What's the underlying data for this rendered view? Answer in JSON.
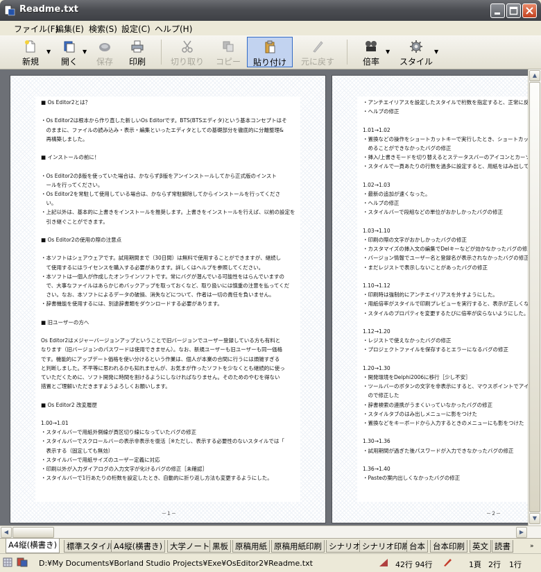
{
  "window": {
    "title": "Readme.txt"
  },
  "menu": [
    "ファイル(F)",
    "編集(E)",
    "検索(S)",
    "設定(C)",
    "ヘルプ(H)"
  ],
  "toolbar": {
    "new": "新規",
    "open": "開く",
    "save": "保存",
    "print": "印刷",
    "cut": "切り取り",
    "copy": "コピー",
    "paste": "貼り付け",
    "undo": "元に戻す",
    "zoom": "倍率",
    "style": "スタイル"
  },
  "left_page": {
    "lines": [
      "■ Os Editor2とは？",
      "",
      "・Os Editor2は根本から作り直した新しいOs Editorです。BTS(BTSエディタ)という基本コンセプトはそ",
      "　のままに、ファイルの読み込み・表示・編集といったエディタとしての基礎部分を徹底的に分離整理&",
      "　再構築しました。",
      "",
      "■ インストールの前に！",
      "",
      "・Os Editor2のβ版を使っていた場合は、かならずβ版をアンインストールしてから正式版のインスト",
      "　ールを行ってください。",
      "・Os Editor2を常駐して使用している場合は、かならず常駐解除してからインストールを行ってくださ",
      "　い。",
      "・上記以外は、基本的に上書きをインストールを推奨します。上書きをインストールを行えば、以前の設定を",
      "　引き継ぐことができます。",
      "",
      "■ Os Editor2の使用の際の注意点",
      "",
      "・本ソフトはシェアウェアです。試用期間まで（30日間）は無料で使用することができますが、継続し",
      "　て使用するにはライセンスを購入する必要があります。詳しくはヘルプを参照してください。",
      "・本ソフトは一個人が作成したオンラインソフトです。常にバグが潜んでいる可能性をはらんでいますの",
      "　で、大事なファイルはあらかじめバックアップを取っておくなど、取り扱いには慎重の注意を払ってくだ",
      "　さい。なお、本ソフトによるデータの破損、消失などについて、作者は一切の責任を負いません。",
      "・辞書機能を使用するには、別途辞書類をダウンロードする必要があります。",
      "",
      "■ 旧ユーザーの方へ",
      "",
      "Os Editor2はメジャーバージョンアップということで旧バージョンでユーザー登録している方も有料と",
      "なります（旧バージョンのパスワードは使用できません）。なお、新規ユーザーも旧ユーザーも同一価格",
      "です。機能的にアップデート価格を使い分けるという作業は、個人が本業の合間に行うには煩雑すぎる",
      "と判断しました。不平等に思われるかも知れませんが、お気まが作ったソフトを少なくとも継続的に使っ",
      "ていただくために、ソフト開発に時間を割けるようにしなければなりません。そのためのやむを得ない",
      "措置とご理解いただきますようよろしくお願いします。",
      "",
      "■ Os Editor2 改変履歴",
      "",
      "1.00→1.01",
      "・スタイルバーで用紙外側線が頁区切り線になっていたバグの修正",
      "・スタイルバーでスクロールバーの表示非表示を復活［※ただし、表示する必要性のないスタイルでは「",
      "　表示する（固定しても無効）",
      "・スタイルバーで用紙サイズのユーザー定義に対応",
      "・印刷以外が入力ダイアログの入力文字が化けるバグの修正［未確認］",
      "・スタイルバーで1行あたりの桁数を設定したとき、自動的に折り返し方法も変更するようにした。"
    ],
    "page_number": "－１－"
  },
  "right_page": {
    "lines": [
      "・アンチエイリアスを設定したスタイルで桁数を指定すると、正常に反映されない",
      "・ヘルプの修正",
      "",
      "1.01→1.02",
      "・置換などの操作をショートカットキーで実行したとき、ショートカットキーを",
      "　めることができなかったバグの修正",
      "・挿入/上書きモードを切り替えるとステータスバーのアイコンとカーソル",
      "・スタイルで一頁あたりの行数を過多に設定すると、用紙をはみ出して",
      "",
      "1.02→1.03",
      "・最新の追加が速くなった。",
      "・ヘルプの修正",
      "・スタイルバーで段組などの単位がおかしかったバグの修正",
      "",
      "1.03→1.10",
      "・印刷の際の文字がおかしかったバグの修正",
      "・カスタマイズの挿入文の編集でDelキーなどが効かなかったバグの修正",
      "・バージョン情報でユーザー名と登録名が表示されなかったバグの修正",
      "・まだレジストで表示しないことがあったバグの修正",
      "",
      "1.10→1.12",
      "・印刷時は強制的にアンチエイリアスを外すようにした。",
      "・用紙倍率がスタイルで印刷プレビューを実行すると、表示が正しくない",
      "・スタイルのプロパティを変更するたびに倍率が戻らないようにした。",
      "",
      "1.12→1.20",
      "・レジストで使えなかったバグの修正",
      "・プロジェクトファイルを保存するとエラーになるバグの修正",
      "",
      "1.20→1.30",
      "・開発環境をDelphi2006に移行［少し不安］",
      "・ツールバーのボタンの文字を非表示にすると、マウスポイントでアイ",
      "　ので修正した",
      "・辞書検索の連携がうまくいっていなかったバグの修正",
      "・スタイルタブのはみ出しメニューに影をつけた",
      "・置換などをキーボードから入力するときのメニューにも影をつけた",
      "",
      "1.30→1.36",
      "・試用期間が過ぎた後パスワードが入力できなかったバグの修正",
      "",
      "1.36→1.40",
      "・Pasteの案内出しくなかったバグの修正"
    ],
    "page_number": "－２－"
  },
  "tabs": [
    "A4縦(横書き)",
    "標準スタイル",
    "A4縦(横書き)",
    "大学ノート",
    "黒板",
    "原稿用紙",
    "原稿用紙印刷",
    "シナリオ",
    "シナリオ印刷",
    "台本",
    "台本印刷",
    "英文",
    "読書"
  ],
  "status": {
    "path": "D:¥My Documents¥Borland Studio Projects¥Exe¥OsEditor2¥Readme.txt",
    "size": "42行 94行",
    "page": "1頁",
    "line": "2行",
    "col": "1行"
  }
}
